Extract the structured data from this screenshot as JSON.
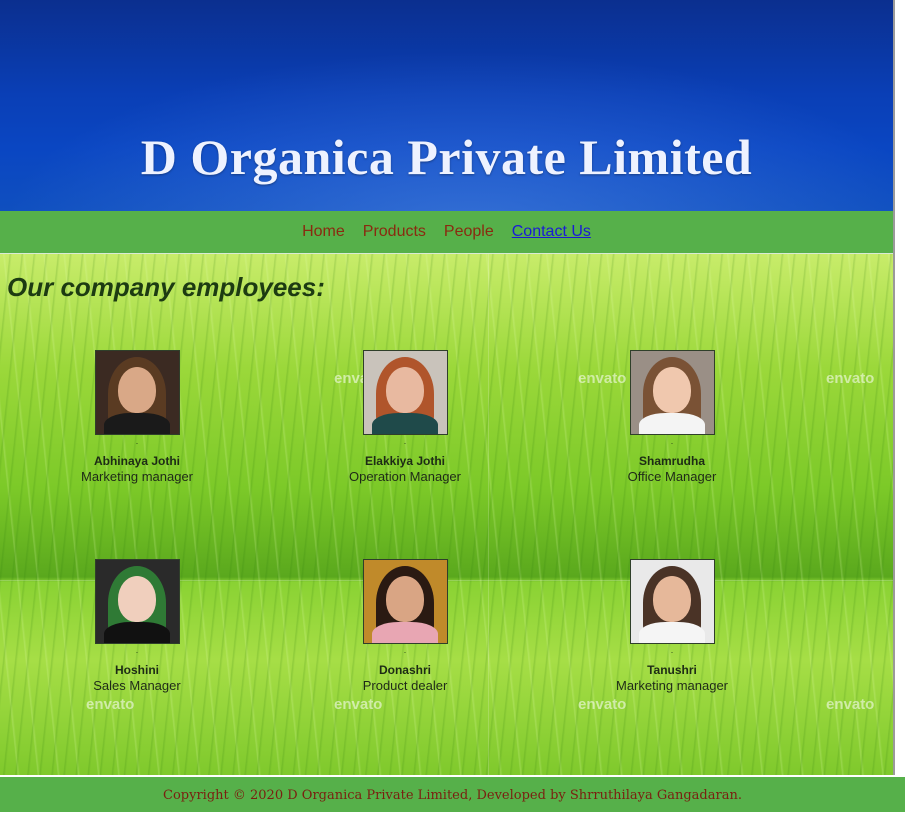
{
  "header": {
    "title": "D Organica Private Limited"
  },
  "nav": {
    "items": [
      {
        "label": "Home"
      },
      {
        "label": "Products"
      },
      {
        "label": "People"
      },
      {
        "label": "Contact Us"
      }
    ]
  },
  "main": {
    "heading": "Our company employees:",
    "watermark": "envato",
    "employees": [
      {
        "name": "Abhinaya Jothi",
        "role": "Marketing manager",
        "photo_icon": "person-photo"
      },
      {
        "name": "Elakkiya Jothi",
        "role": "Operation Manager",
        "photo_icon": "person-photo"
      },
      {
        "name": "Shamrudha",
        "role": "Office Manager",
        "photo_icon": "person-photo"
      },
      {
        "name": "Hoshini",
        "role": "Sales Manager",
        "photo_icon": "person-photo"
      },
      {
        "name": "Donashri",
        "role": "Product dealer",
        "photo_icon": "person-photo"
      },
      {
        "name": "Tanushri",
        "role": "Marketing manager",
        "photo_icon": "person-photo"
      }
    ]
  },
  "footer": {
    "copyright": "Copyright © 2020 D Organica Private Limited, Developed by Shrruthilaya Gangadaran."
  },
  "colors": {
    "header_blue": "#0a3fb6",
    "nav_green": "#56b04a",
    "nav_link": "#8a2a10",
    "active_link": "#1a1ad6",
    "footer_text": "#7a1f10"
  }
}
